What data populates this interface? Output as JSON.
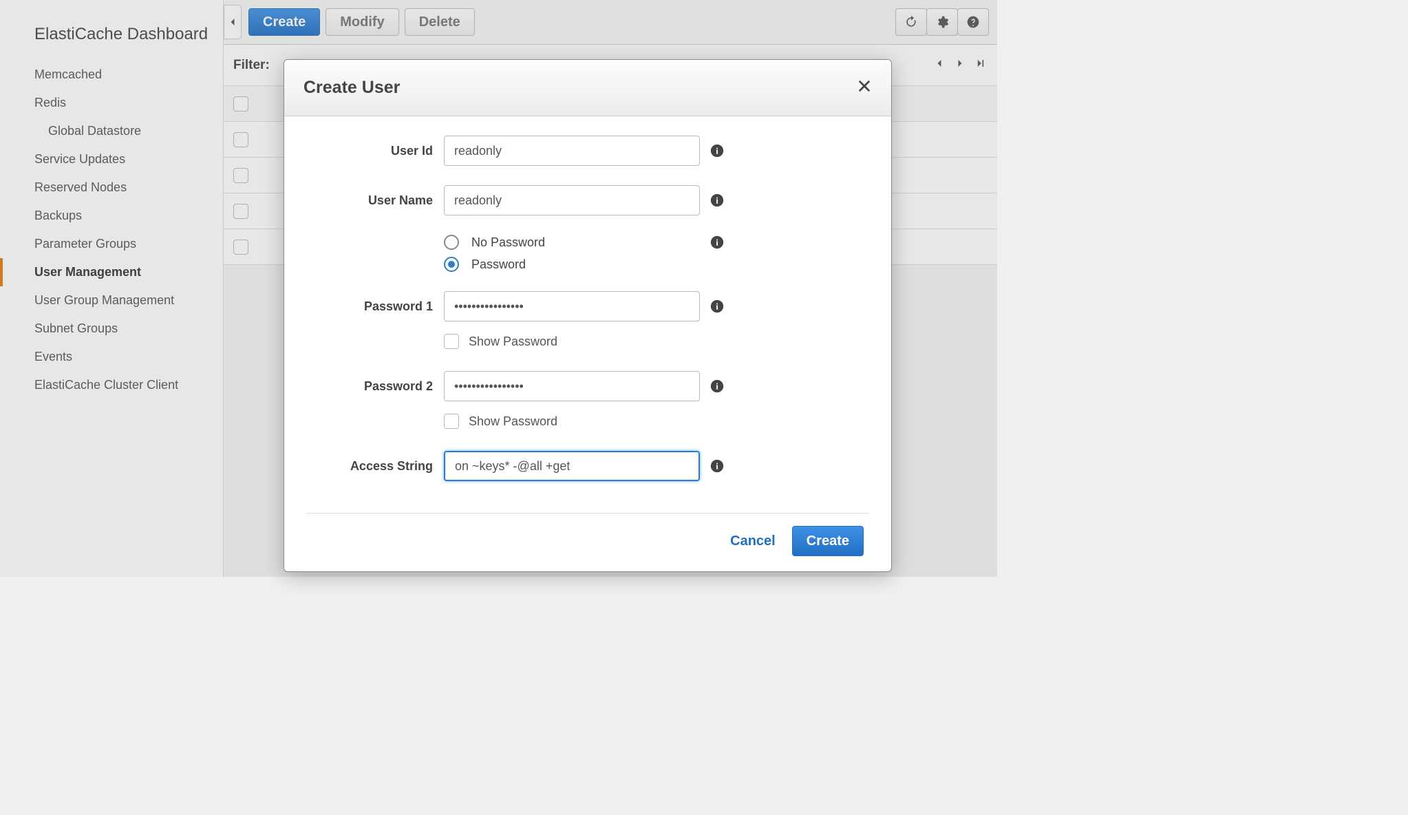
{
  "sidebar": {
    "title": "ElastiCache Dashboard",
    "items": [
      {
        "label": "Memcached",
        "sub": false,
        "active": false
      },
      {
        "label": "Redis",
        "sub": false,
        "active": false
      },
      {
        "label": "Global Datastore",
        "sub": true,
        "active": false
      },
      {
        "label": "Service Updates",
        "sub": false,
        "active": false
      },
      {
        "label": "Reserved Nodes",
        "sub": false,
        "active": false
      },
      {
        "label": "Backups",
        "sub": false,
        "active": false
      },
      {
        "label": "Parameter Groups",
        "sub": false,
        "active": false
      },
      {
        "label": "User Management",
        "sub": false,
        "active": true
      },
      {
        "label": "User Group Management",
        "sub": false,
        "active": false
      },
      {
        "label": "Subnet Groups",
        "sub": false,
        "active": false
      },
      {
        "label": "Events",
        "sub": false,
        "active": false
      },
      {
        "label": "ElastiCache Cluster Client",
        "sub": false,
        "active": false
      }
    ]
  },
  "toolbar": {
    "create_label": "Create",
    "modify_label": "Modify",
    "delete_label": "Delete"
  },
  "filterbar": {
    "label": "Filter:"
  },
  "modal": {
    "title": "Create User",
    "labels": {
      "user_id": "User Id",
      "user_name": "User Name",
      "no_password": "No Password",
      "password": "Password",
      "password1": "Password 1",
      "password2": "Password 2",
      "show_password": "Show Password",
      "access_string": "Access String"
    },
    "values": {
      "user_id": "readonly",
      "user_name": "readonly",
      "password_mode": "password",
      "password1": "••••••••••••••••",
      "password2": "••••••••••••••••",
      "access_string": "on ~keys* -@all +get"
    },
    "footer": {
      "cancel": "Cancel",
      "create": "Create"
    }
  }
}
